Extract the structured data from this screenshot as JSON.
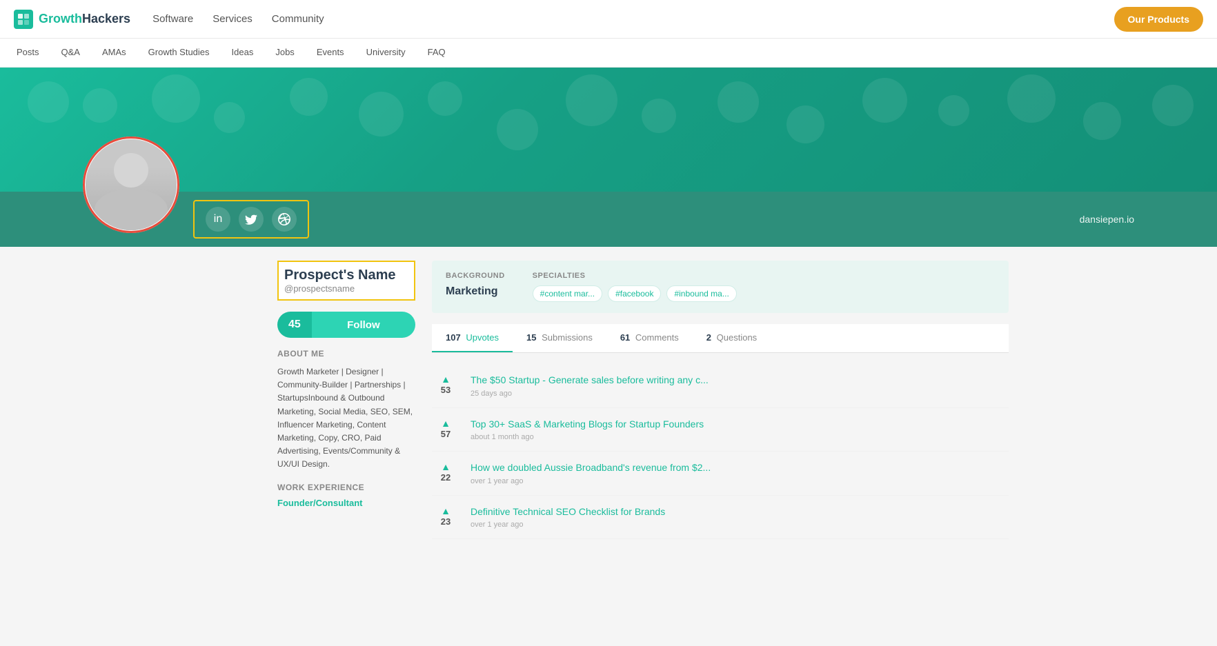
{
  "logo": {
    "icon": "GH",
    "brand": "Growth",
    "brand2": "Hackers"
  },
  "nav": {
    "links": [
      "Software",
      "Services",
      "Community"
    ],
    "cta": "Our Products"
  },
  "secondary_nav": {
    "links": [
      "Posts",
      "Q&A",
      "AMAs",
      "Growth Studies",
      "Ideas",
      "Jobs",
      "Events",
      "University",
      "FAQ"
    ]
  },
  "profile": {
    "name": "Prospect's Name",
    "handle": "@prospectsname",
    "website": "dansiepen.io",
    "follow_count": "45",
    "follow_label": "Follow",
    "background_label": "BACKGROUND",
    "background_value": "Marketing",
    "specialties_label": "SPECIALTIES",
    "specialties": [
      "#content mar...",
      "#facebook",
      "#inbound ma..."
    ],
    "about_me_label": "ABOUT ME",
    "about_me_text": "Growth Marketer | Designer | Community-Builder | Partnerships | StartupsInbound & Outbound Marketing, Social Media, SEO, SEM, Influencer Marketing, Content Marketing, Copy, CRO, Paid Advertising, Events/Community & UX/UI Design.",
    "work_exp_label": "WORK EXPERIENCE",
    "work_exp_value": "Founder/Consultant"
  },
  "tabs": [
    {
      "count": "107",
      "label": "Upvotes",
      "active": true
    },
    {
      "count": "15",
      "label": "Submissions",
      "active": false
    },
    {
      "count": "61",
      "label": "Comments",
      "active": false
    },
    {
      "count": "2",
      "label": "Questions",
      "active": false
    }
  ],
  "posts": [
    {
      "votes": "53",
      "title": "The $50 Startup - Generate sales before writing any c...",
      "time": "25 days ago"
    },
    {
      "votes": "57",
      "title": "Top 30+ SaaS & Marketing Blogs for Startup Founders",
      "time": "about 1 month ago"
    },
    {
      "votes": "22",
      "title": "How we doubled Aussie Broadband's revenue from $2...",
      "time": "over 1 year ago"
    },
    {
      "votes": "23",
      "title": "Definitive Technical SEO Checklist for Brands",
      "time": "over 1 year ago"
    }
  ],
  "social_icons": [
    {
      "name": "linkedin-icon",
      "symbol": "in"
    },
    {
      "name": "twitter-icon",
      "symbol": "𝕥"
    },
    {
      "name": "dribbble-icon",
      "symbol": "🏀"
    }
  ]
}
